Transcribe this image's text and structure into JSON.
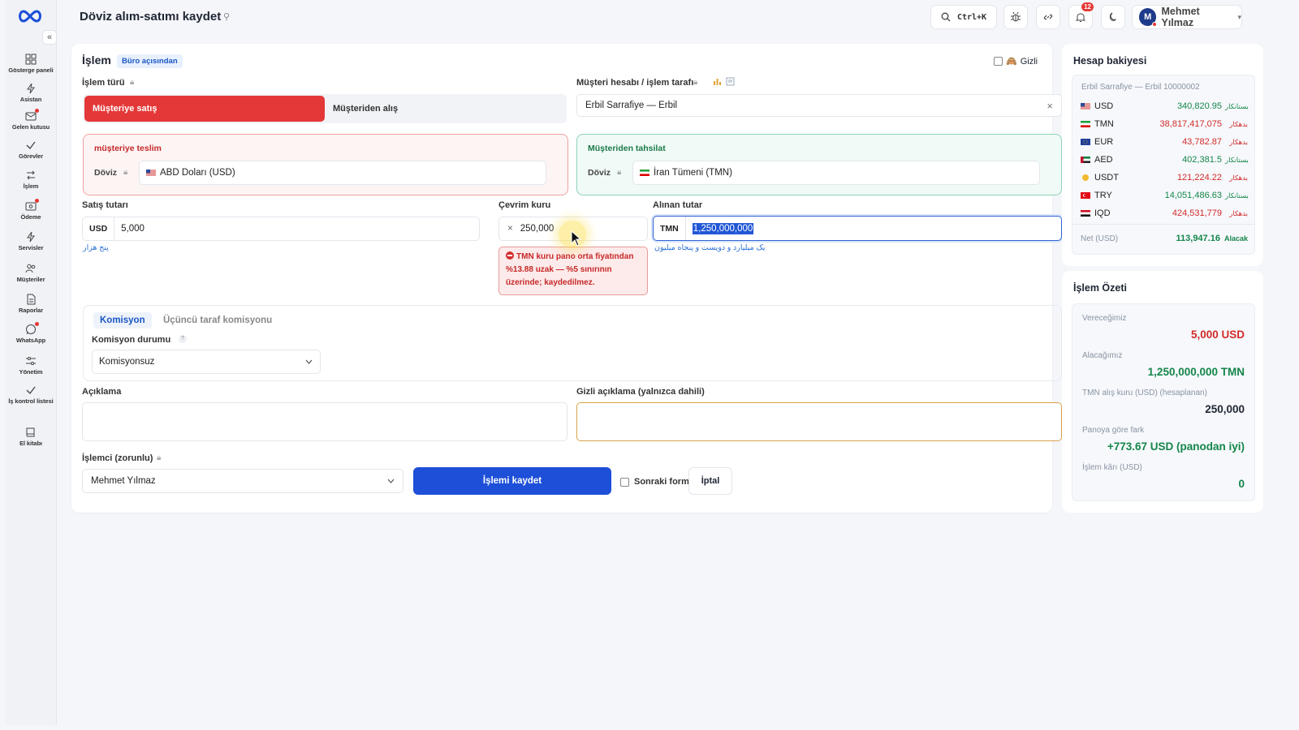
{
  "app": {
    "page_title": "Döviz alım-satımı kaydet"
  },
  "sidebar": {
    "collapse_label": "«",
    "items": [
      {
        "label": "Gösterge paneli",
        "icon": "dashboard-icon"
      },
      {
        "label": "Asistan",
        "icon": "bolt-icon"
      },
      {
        "label": "Gelen kutusu",
        "icon": "inbox-icon"
      },
      {
        "label": "Görevler",
        "icon": "check-icon"
      },
      {
        "label": "İşlem",
        "icon": "swap-icon"
      },
      {
        "label": "Ödeme",
        "icon": "wallet-icon"
      },
      {
        "label": "Servisler",
        "icon": "bolt-icon"
      },
      {
        "label": "Müşteriler",
        "icon": "users-icon"
      },
      {
        "label": "Raporlar",
        "icon": "report-icon"
      },
      {
        "label": "WhatsApp",
        "icon": "chat-icon"
      },
      {
        "label": "Yönetim",
        "icon": "sliders-icon"
      },
      {
        "label": "İş kontrol listesi",
        "icon": "check-icon"
      },
      {
        "label": "El kitabı",
        "icon": "book-icon"
      }
    ]
  },
  "header": {
    "search_shortcut": "Ctrl+K",
    "notification_count": "12",
    "user_initial": "M",
    "user_name": "Mehmet Yılmaz",
    "user_caret": "▾"
  },
  "form": {
    "title": "İşlem",
    "view_badge": "Büro açısından",
    "hidden_label": "Gizli",
    "type_label": "İşlem türü",
    "type_options": [
      "Müşteriye satış",
      "Müşteriden alış"
    ],
    "account_label": "Müşteri hesabı / işlem tarafı",
    "account_value": "Erbil Sarrafiye — Erbil",
    "clear_symbol": "×",
    "deliver": {
      "title": "müşteriye teslim",
      "currency_label": "Döviz",
      "currency_value": "ABD Doları (USD)"
    },
    "collect": {
      "title": "Müşteriden tahsilat",
      "currency_label": "Döviz",
      "currency_value": "İran Tümeni (TMN)"
    },
    "sale_amount_label": "Satış tutarı",
    "sale_currency": "USD",
    "sale_amount": "5,000",
    "sale_amount_words": "پنج هزار",
    "rate_label": "Çevrim kuru",
    "rate_prefix": "×",
    "rate_value": "250,000",
    "rate_error": "TMN kuru pano orta fiyatından %13.88 uzak — %5 sınırının üzerinde; kaydedilmez.",
    "received_label": "Alınan tutar",
    "received_currency": "TMN",
    "received_amount": "1,250,000,000",
    "received_amount_words": "یک میلیارد و دویست و پنجاه میلیون",
    "commission": {
      "tab_active": "Komisyon",
      "tab_inactive": "Üçüncü taraf komisyonu",
      "status_label": "Komisyon durumu",
      "status_value": "Komisyonsuz"
    },
    "description_label": "Açıklama",
    "hidden_description_label": "Gizli açıklama (yalnızca dahili)",
    "operator_label": "İşlemci (zorunlu)",
    "operator_value": "Mehmet Yılmaz",
    "save_label": "İşlemi kaydet",
    "next_form_label": "Sonraki form",
    "cancel_label": "İptal"
  },
  "balance": {
    "title": "Hesap bakiyesi",
    "account": "Erbil Sarrafiye — Erbil 10000002",
    "rows": [
      {
        "currency": "USD",
        "amount": "340,820.95",
        "tag": "بستانکار",
        "status": "credit"
      },
      {
        "currency": "TMN",
        "amount": "38,817,417,075",
        "tag": "بدهکار",
        "status": "debit"
      },
      {
        "currency": "EUR",
        "amount": "43,782.87",
        "tag": "بدهکار",
        "status": "debit"
      },
      {
        "currency": "AED",
        "amount": "402,381.5",
        "tag": "بستانکار",
        "status": "credit"
      },
      {
        "currency": "USDT",
        "amount": "121,224.22",
        "tag": "بدهکار",
        "status": "debit"
      },
      {
        "currency": "TRY",
        "amount": "14,051,486.63",
        "tag": "بستانکار",
        "status": "credit"
      },
      {
        "currency": "IQD",
        "amount": "424,531,779",
        "tag": "بدهکار",
        "status": "debit"
      }
    ],
    "net_label": "Net (USD)",
    "net_value": "113,947.16",
    "net_tag": "Alacak"
  },
  "summary": {
    "title": "İşlem Özeti",
    "items": [
      {
        "label": "Vereceğimiz",
        "value": "5,000 USD"
      },
      {
        "label": "Alacağımız",
        "value": "1,250,000,000 TMN"
      },
      {
        "label": "TMN alış kuru (USD) (hesaplanan)",
        "value": "250,000"
      },
      {
        "label": "Panoya göre fark",
        "value": "+773.67 USD (panodan iyi)"
      },
      {
        "label": "İşlem kârı (USD)",
        "value": "0"
      }
    ]
  },
  "colors": {
    "accent": "#1d4fd8",
    "sell": "#e43838",
    "credit": "#14864a",
    "debit": "#d22a2a"
  }
}
